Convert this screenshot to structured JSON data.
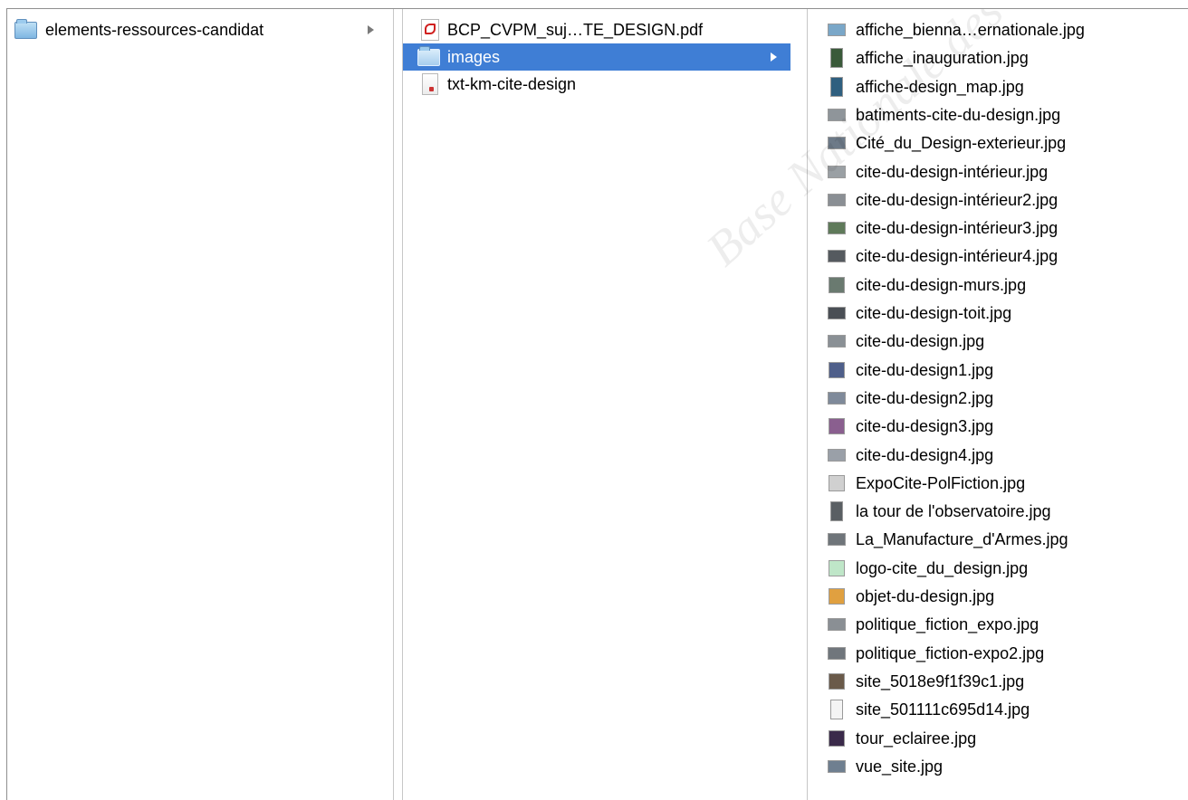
{
  "browser": {
    "column1": {
      "items": [
        {
          "label": "elements-ressources-candidat",
          "icon": "folder-icon",
          "has_children": true,
          "selected": false
        }
      ]
    },
    "column2": {
      "items": [
        {
          "label": "BCP_CVPM_suj…TE_DESIGN.pdf",
          "icon": "pdf-file-icon",
          "has_children": false,
          "selected": false
        },
        {
          "label": "images",
          "icon": "folder-icon",
          "has_children": true,
          "selected": true
        },
        {
          "label": "txt-km-cite-design",
          "icon": "text-document-icon",
          "has_children": false,
          "selected": false
        }
      ]
    },
    "column3": {
      "items": [
        {
          "label": "affiche_bienna…ernationale.jpg",
          "icon": "image-thumbnail-icon",
          "thumb": "#7aa7c8"
        },
        {
          "label": "affiche_inauguration.jpg",
          "icon": "image-thumbnail-icon",
          "thumb": "#3a5a3a"
        },
        {
          "label": "affiche-design_map.jpg",
          "icon": "image-thumbnail-icon",
          "thumb": "#2f5f7f"
        },
        {
          "label": "batiments-cite-du-design.jpg",
          "icon": "image-thumbnail-icon",
          "thumb": "#8f959a"
        },
        {
          "label": "Cité_du_Design-exterieur.jpg",
          "icon": "image-thumbnail-icon",
          "thumb": "#6d7a88"
        },
        {
          "label": "cite-du-design-intérieur.jpg",
          "icon": "image-thumbnail-icon",
          "thumb": "#9aa0a4"
        },
        {
          "label": "cite-du-design-intérieur2.jpg",
          "icon": "image-thumbnail-icon",
          "thumb": "#8a8f94"
        },
        {
          "label": "cite-du-design-intérieur3.jpg",
          "icon": "image-thumbnail-icon",
          "thumb": "#5f7a5a"
        },
        {
          "label": "cite-du-design-intérieur4.jpg",
          "icon": "image-thumbnail-icon",
          "thumb": "#555a5f"
        },
        {
          "label": "cite-du-design-murs.jpg",
          "icon": "image-thumbnail-icon",
          "thumb": "#6a7a70"
        },
        {
          "label": "cite-du-design-toit.jpg",
          "icon": "image-thumbnail-icon",
          "thumb": "#4a4f55"
        },
        {
          "label": "cite-du-design.jpg",
          "icon": "image-thumbnail-icon",
          "thumb": "#8a9095"
        },
        {
          "label": "cite-du-design1.jpg",
          "icon": "image-thumbnail-icon",
          "thumb": "#4f5f8a"
        },
        {
          "label": "cite-du-design2.jpg",
          "icon": "image-thumbnail-icon",
          "thumb": "#7f8a9a"
        },
        {
          "label": "cite-du-design3.jpg",
          "icon": "image-thumbnail-icon",
          "thumb": "#8a5f8f"
        },
        {
          "label": "cite-du-design4.jpg",
          "icon": "image-thumbnail-icon",
          "thumb": "#9aa0a8"
        },
        {
          "label": "ExpoCite-PolFiction.jpg",
          "icon": "image-thumbnail-icon",
          "thumb": "#d0d0d0"
        },
        {
          "label": "la tour de l'observatoire.jpg",
          "icon": "image-thumbnail-icon",
          "thumb": "#5a5f63"
        },
        {
          "label": "La_Manufacture_d'Armes.jpg",
          "icon": "image-thumbnail-icon",
          "thumb": "#6f757a"
        },
        {
          "label": "logo-cite_du_design.jpg",
          "icon": "image-thumbnail-icon",
          "thumb": "#bfe6c8"
        },
        {
          "label": "objet-du-design.jpg",
          "icon": "image-thumbnail-icon",
          "thumb": "#e0a040"
        },
        {
          "label": "politique_fiction_expo.jpg",
          "icon": "image-thumbnail-icon",
          "thumb": "#8a8f94"
        },
        {
          "label": "politique_fiction-expo2.jpg",
          "icon": "image-thumbnail-icon",
          "thumb": "#70767c"
        },
        {
          "label": "site_5018e9f1f39c1.jpg",
          "icon": "image-thumbnail-icon",
          "thumb": "#6a5a4a"
        },
        {
          "label": "site_501111c695d14.jpg",
          "icon": "image-thumbnail-icon",
          "thumb": "#f4f4f4"
        },
        {
          "label": "tour_eclairee.jpg",
          "icon": "image-thumbnail-icon",
          "thumb": "#3a2a4a"
        },
        {
          "label": "vue_site.jpg",
          "icon": "image-thumbnail-icon",
          "thumb": "#6f7f90"
        }
      ]
    }
  },
  "watermark": {
    "text": "Base Nationale des Sujets"
  }
}
